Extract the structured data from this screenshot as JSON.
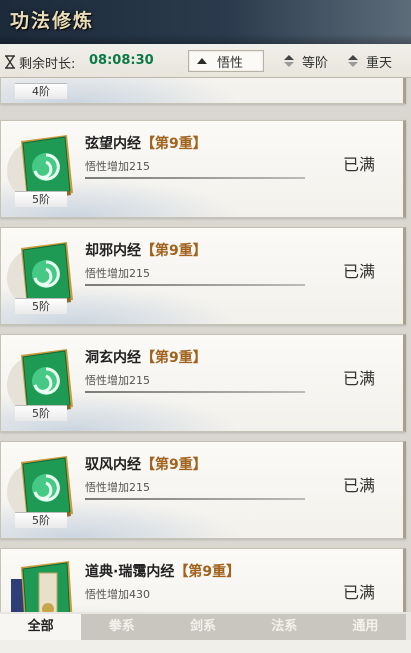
{
  "header": {
    "title": "功法修炼"
  },
  "toolbar": {
    "timer_label": "剩余时长:",
    "timer_value": "08:08:30",
    "sort_buttons": [
      {
        "label": "悟性",
        "active": true
      },
      {
        "label": "等阶",
        "active": false
      },
      {
        "label": "重天",
        "active": false
      }
    ]
  },
  "partial_card": {
    "tier": "4阶"
  },
  "cards": [
    {
      "name": "弦望内经",
      "level": "【第9重】",
      "effect": "悟性增加215",
      "tier": "5阶",
      "status": "已满"
    },
    {
      "name": "却邪内经",
      "level": "【第9重】",
      "effect": "悟性增加215",
      "tier": "5阶",
      "status": "已满"
    },
    {
      "name": "洞玄内经",
      "level": "【第9重】",
      "effect": "悟性增加215",
      "tier": "5阶",
      "status": "已满"
    },
    {
      "name": "驭风内经",
      "level": "【第9重】",
      "effect": "悟性增加215",
      "tier": "5阶",
      "status": "已满"
    },
    {
      "name": "道典·瑞霭内经",
      "level": "【第9重】",
      "effect": "悟性增加430",
      "tier": "",
      "status": "已满"
    }
  ],
  "tabs": [
    {
      "label": "全部",
      "active": true
    },
    {
      "label": "拳系",
      "active": false
    },
    {
      "label": "剑系",
      "active": false
    },
    {
      "label": "法系",
      "active": false
    },
    {
      "label": "通用",
      "active": false
    }
  ],
  "colors": {
    "timer": "#0c7a46",
    "level": "#a0621c",
    "book_green": "#1f9a55",
    "header_dark": "#1c2a3a"
  }
}
